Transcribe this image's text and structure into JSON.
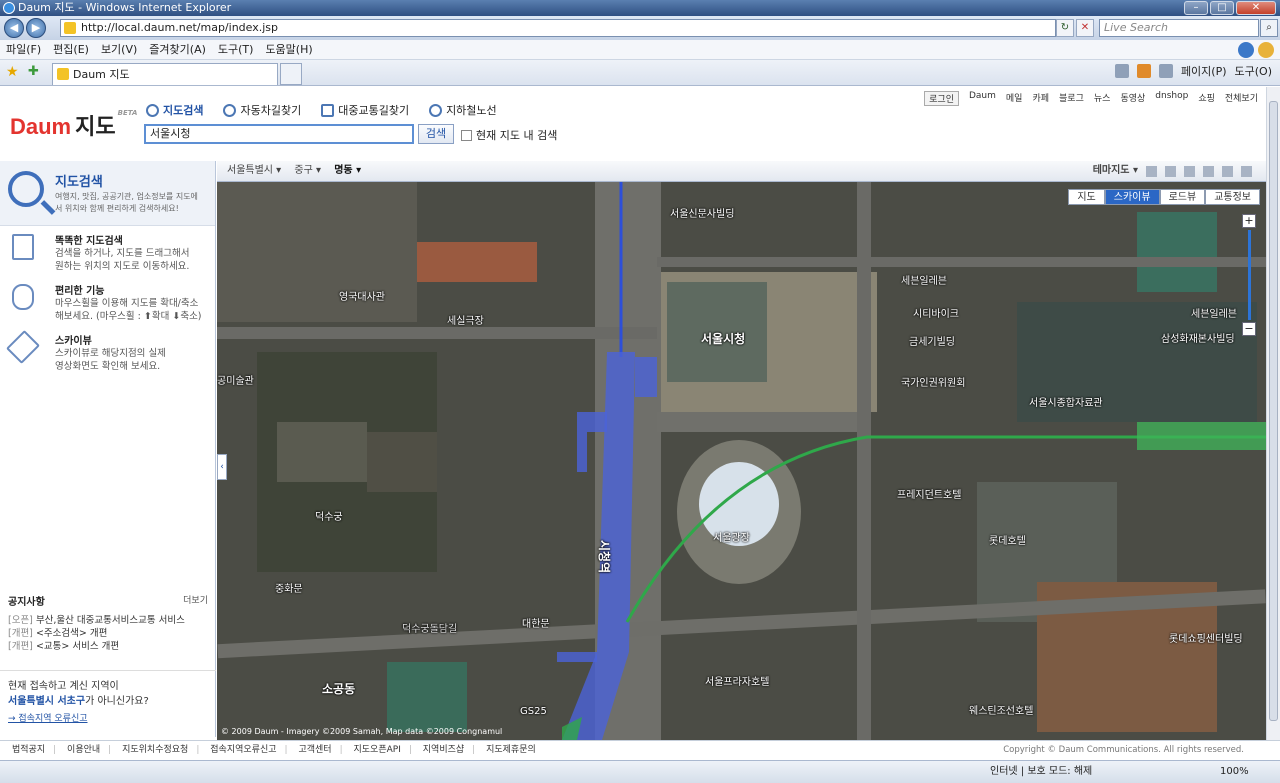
{
  "window": {
    "title": "Daum 지도 - Windows Internet Explorer"
  },
  "browser": {
    "url": "http://local.daum.net/map/index.jsp",
    "live_search_placeholder": "Live Search",
    "menu": [
      "파일(F)",
      "편집(E)",
      "보기(V)",
      "즐겨찾기(A)",
      "도구(T)",
      "도움말(H)"
    ],
    "tab_title": "Daum 지도",
    "cmd": {
      "page": "페이지(P)",
      "tools": "도구(O)"
    },
    "status": {
      "zone": "인터넷 | 보호 모드: 해제",
      "zoom": "100%"
    }
  },
  "header": {
    "logo_daum": "Daum",
    "logo_jido": "지도",
    "logo_beta": "BETA",
    "search_tabs": [
      "지도검색",
      "자동차길찾기",
      "대중교통길찾기",
      "지하철노선"
    ],
    "search_value": "서울시청",
    "search_button": "검색",
    "checkbox_label": "현재 지도 내 검색",
    "top_links": [
      "로그인",
      "Daum",
      "메일",
      "카페",
      "블로그",
      "뉴스",
      "동영상",
      "dnshop",
      "쇼핑",
      "전체보기"
    ]
  },
  "sidebar": {
    "title": "지도검색",
    "description": "여행지, 맛집, 공공기관, 업소정보를 지도에서 위치와 함께 편리하게 검색하세요!",
    "features": [
      {
        "title": "똑똑한 지도검색",
        "desc1": "검색을 하거나, 지도를 드래그해서",
        "desc2": "원하는 위치의 지도로 이동하세요."
      },
      {
        "title": "편리한 기능",
        "desc1": "마우스휠을 이용해 지도를 확대/축소",
        "desc2": "해보세요. (마우스휠 : ⬆확대 ⬇축소)"
      },
      {
        "title": "스카이뷰",
        "desc1": "스카이뷰로 해당지점의 실제",
        "desc2": "영상화면도 확인해 보세요."
      }
    ],
    "notice_title": "공지사항",
    "notice_more": "더보기",
    "notices": [
      {
        "tag": "[오픈]",
        "text": "부산,울산 대중교통서비스교통 서비스"
      },
      {
        "tag": "[개편]",
        "text": "<주소검색> 개편"
      },
      {
        "tag": "[개편]",
        "text": "<교통> 서비스 개편"
      }
    ],
    "region_line1": "현재 접속하고 계신 지역이",
    "region_city": "서울특별시 서초구",
    "region_suffix": "가 아니신가요?",
    "region_report": "→ 접속지역 오류신고"
  },
  "mapbar": {
    "breadcrumbs": [
      "서울특별시 ▾",
      "중구 ▾",
      "명동 ▾"
    ],
    "theme": "테마지도 ▾"
  },
  "map": {
    "types": [
      "지도",
      "스카이뷰",
      "로드뷰",
      "교통정보"
    ],
    "active_type": "스카이뷰",
    "labels": {
      "cityhall": "서울시청",
      "plaza": "서울광장",
      "station": "시청역",
      "embassy": "영국대사관",
      "theater": "세실극장",
      "deoksugung": "덕수궁",
      "junghwamun": "중화문",
      "daehanmun": "대한문",
      "sogongdong": "소공동",
      "deoksugung_road": "덕수궁돌담길",
      "gs25": "GS25",
      "seoul_sinmun": "서울신문사빌딩",
      "seven_eleven1": "세븐일레븐",
      "seven_eleven2": "세븐일레븐",
      "citybike": "시티바이크",
      "geumse": "금세기빌딩",
      "gukga": "국가인권위원회",
      "archive": "서울시종합자료관",
      "samsung": "삼성화재본사빌딩",
      "president": "프레지던트호텔",
      "lotte": "롯데호텔",
      "plaza_hotel": "서울프라자호텔",
      "westin": "웨스틴조선호텔",
      "lotte_shopping": "롯데쇼핑센터빌딩",
      "gongmi": "공미술관"
    },
    "copyright": "© 2009 Daum - Imagery ©2009 Samah, Map data ©2009 Congnamul"
  },
  "footer": {
    "links": [
      "법적공지",
      "이용안내",
      "지도위치수정요청",
      "접속지역오류신고",
      "고객센터",
      "지도오픈API",
      "지역비즈샵",
      "지도제휴문의"
    ],
    "copyright": "Copyright © Daum Communications. All rights reserved."
  },
  "colors": {
    "accent": "#2b67c5",
    "subway_line1": "#2d4fd8",
    "subway_line2": "#2fa84a"
  }
}
